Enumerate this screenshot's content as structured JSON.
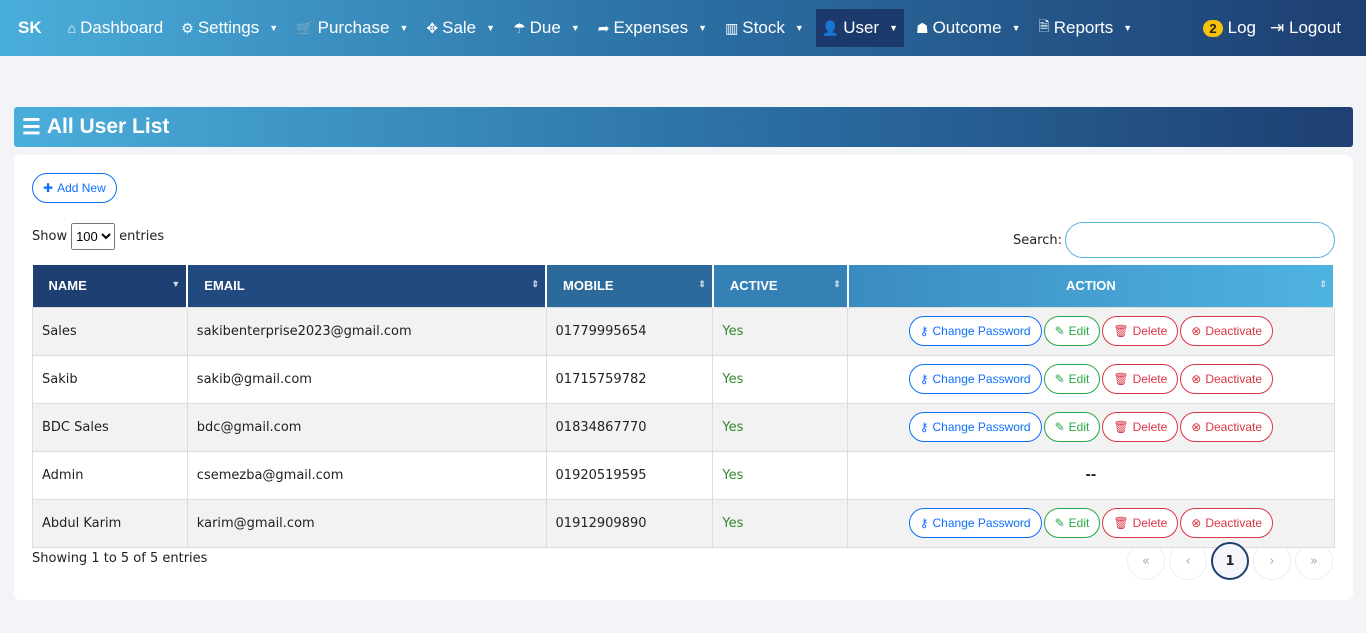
{
  "nav": {
    "brand": "SK",
    "items": [
      {
        "icon": "home-icon",
        "glyph": "⌂",
        "label": "Dashboard",
        "caret": false
      },
      {
        "icon": "gears-icon",
        "glyph": "⚙",
        "label": "Settings",
        "caret": true
      },
      {
        "icon": "cart-icon",
        "glyph": "🛒",
        "label": "Purchase",
        "caret": true
      },
      {
        "icon": "arrows-icon",
        "glyph": "✥",
        "label": "Sale",
        "caret": true
      },
      {
        "icon": "umbrella-icon",
        "glyph": "☂",
        "label": "Due",
        "caret": true
      },
      {
        "icon": "share-icon",
        "glyph": "➦",
        "label": "Expenses",
        "caret": true
      },
      {
        "icon": "bar-chart-icon",
        "glyph": "▥",
        "label": "Stock",
        "caret": true
      },
      {
        "icon": "user-icon",
        "glyph": "👤",
        "label": "User",
        "caret": true,
        "active": true
      },
      {
        "icon": "user-secret-icon",
        "glyph": "☗",
        "label": "Outcome",
        "caret": true
      },
      {
        "icon": "pdf-file-icon",
        "glyph": "🗎",
        "label": "Reports",
        "caret": true
      }
    ],
    "log_badge": "2",
    "log": "Log",
    "logout": "Logout"
  },
  "page": {
    "title": "All User List",
    "add_new": "Add New",
    "show": "Show",
    "entries_value": "100",
    "entries": "entries",
    "search_label": "Search:",
    "search_value": "",
    "info": "Showing 1 to 5 of 5 entries",
    "current_page": "1"
  },
  "table": {
    "headers": [
      "NAME",
      "EMAIL",
      "MOBILE",
      "ACTIVE",
      "ACTION"
    ],
    "actions": {
      "change_password": "Change Password",
      "edit": "Edit",
      "delete": "Delete",
      "deactivate": "Deactivate",
      "none": "--"
    },
    "rows": [
      {
        "name": "Sales",
        "email": "sakibenterprise2023@gmail.com",
        "mobile": "01779995654",
        "active": "Yes",
        "has_actions": true
      },
      {
        "name": "Sakib",
        "email": "sakib@gmail.com",
        "mobile": "01715759782",
        "active": "Yes",
        "has_actions": true
      },
      {
        "name": "BDC Sales",
        "email": "bdc@gmail.com",
        "mobile": "01834867770",
        "active": "Yes",
        "has_actions": true
      },
      {
        "name": "Admin",
        "email": "csemezba@gmail.com",
        "mobile": "01920519595",
        "active": "Yes",
        "has_actions": false
      },
      {
        "name": "Abdul Karim",
        "email": "karim@gmail.com",
        "mobile": "01912909890",
        "active": "Yes",
        "has_actions": true
      }
    ]
  }
}
